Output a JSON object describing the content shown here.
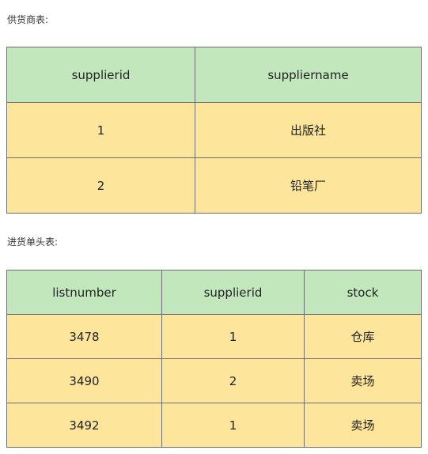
{
  "supplier_section": {
    "caption": "供货商表:",
    "headers": [
      "supplierid",
      "suppliername"
    ],
    "rows": [
      [
        "1",
        "出版社"
      ],
      [
        "2",
        "铅笔厂"
      ]
    ]
  },
  "purchase_section": {
    "caption": "进货单头表:",
    "headers": [
      "listnumber",
      "supplierid",
      "stock"
    ],
    "rows": [
      [
        "3478",
        "1",
        "仓库"
      ],
      [
        "3490",
        "2",
        "卖场"
      ],
      [
        "3492",
        "1",
        "卖场"
      ]
    ]
  },
  "colors": {
    "header_bg": "#c2e7bd",
    "cell_bg": "#fde69b",
    "border": "#6f6f6f"
  }
}
